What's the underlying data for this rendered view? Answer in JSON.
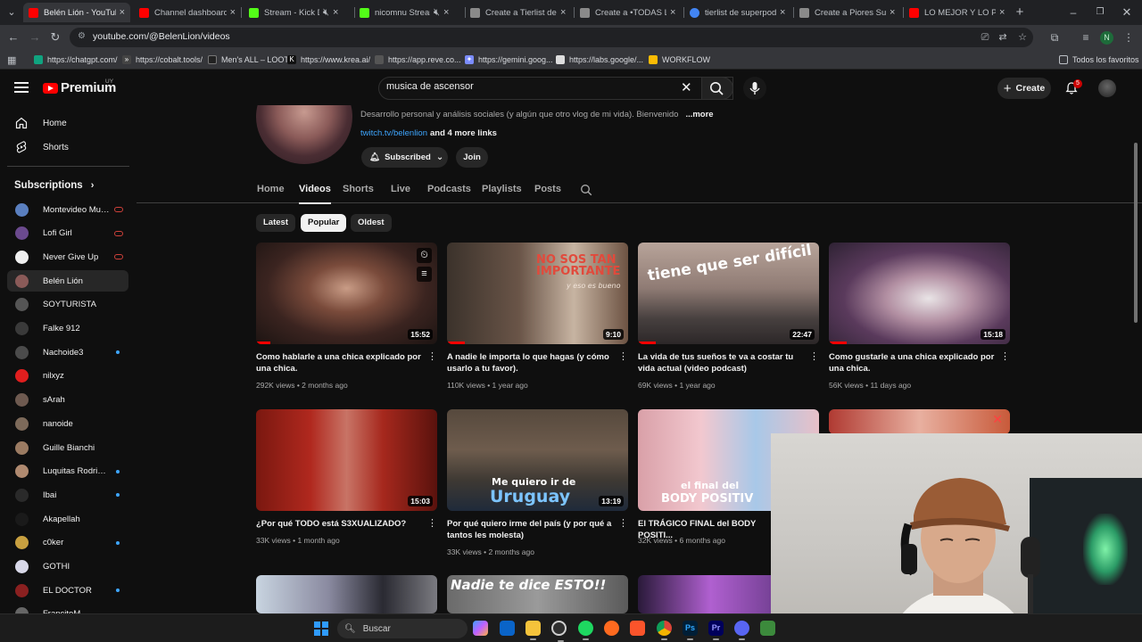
{
  "browser": {
    "tabs": [
      {
        "title": "Belén Lión - YouTube",
        "active": true,
        "favicon_color": "#ff0000"
      },
      {
        "title": "Channel dashboard -",
        "active": false,
        "favicon_color": "#ff0000"
      },
      {
        "title": "Stream - Kick Das",
        "active": false,
        "favicon_color": "#53fc18",
        "muted": true
      },
      {
        "title": "nicomnu Stream",
        "active": false,
        "favicon_color": "#53fc18",
        "muted": true
      },
      {
        "title": "Create a Tierlist de vi",
        "active": false,
        "favicon_color": "#8a8a8a"
      },
      {
        "title": "Create a •TODAS LAS",
        "active": false,
        "favicon_color": "#8a8a8a"
      },
      {
        "title": "tierlist de superpode",
        "active": false,
        "favicon_color": "#4285f4"
      },
      {
        "title": "Create a Piores Supe",
        "active": false,
        "favicon_color": "#8a8a8a"
      },
      {
        "title": "LO MEJOR Y LO PEO",
        "active": false,
        "favicon_color": "#ff0000"
      }
    ],
    "new_tab": "+",
    "url": "youtube.com/@BelenLion/videos",
    "profile_initial": "N",
    "bookmarks": [
      {
        "label": "https://chatgpt.com/",
        "icon_color": "#10a37f"
      },
      {
        "label": "https://cobalt.tools/",
        "icon_color": "#444444"
      },
      {
        "label": "Men's ALL – LOOT",
        "icon_color": "#222222"
      },
      {
        "label": "https://www.krea.ai/",
        "icon_color": "#111111"
      },
      {
        "label": "https://app.reve.co...",
        "icon_color": "#555555"
      },
      {
        "label": "https://gemini.goog...",
        "icon_color": "#7b8cff"
      },
      {
        "label": "https://labs.google/...",
        "icon_color": "#dddddd"
      },
      {
        "label": "WORKFLOW",
        "icon_color": "#fbbc04"
      }
    ],
    "all_bookmarks": "Todos los favoritos"
  },
  "youtube": {
    "logo_text": "Premium",
    "country_code": "UY",
    "search_query": "musica de ascensor",
    "create_label": "Create",
    "notifications_count": "5",
    "sidebar": {
      "items": [
        {
          "label": "Home",
          "icon": "home-icon"
        },
        {
          "label": "Shorts",
          "icon": "shorts-icon"
        }
      ],
      "subscriptions_heading": "Subscriptions",
      "subscriptions": [
        {
          "name": "Montevideo Mus...",
          "color": "#5a7fbf",
          "status": "live"
        },
        {
          "name": "Lofi Girl",
          "color": "#6b4a8e",
          "status": "live"
        },
        {
          "name": "Never Give Up",
          "color": "#f0f0f0",
          "status": "live"
        },
        {
          "name": "Belén Lión",
          "color": "#8a5a58",
          "status": "selected"
        },
        {
          "name": "SOYTURISTA",
          "color": "#555555",
          "status": "none"
        },
        {
          "name": "Falke 912",
          "color": "#3a3a3a",
          "status": "none"
        },
        {
          "name": "Nachoide3",
          "color": "#4b4b4b",
          "status": "new"
        },
        {
          "name": "nilxyz",
          "color": "#e01e1e",
          "status": "none"
        },
        {
          "name": "sArah",
          "color": "#6e5a50",
          "status": "none"
        },
        {
          "name": "nanoide",
          "color": "#7d6a5a",
          "status": "none"
        },
        {
          "name": "Guille Bianchi",
          "color": "#9b7b62",
          "status": "none"
        },
        {
          "name": "Luquitas Rodrigu...",
          "color": "#b08a70",
          "status": "new"
        },
        {
          "name": "Ibai",
          "color": "#2a2a2a",
          "status": "new"
        },
        {
          "name": "Akapellah",
          "color": "#1a1a1a",
          "status": "none"
        },
        {
          "name": "c0ker",
          "color": "#c8a040",
          "status": "new"
        },
        {
          "name": "GOTHI",
          "color": "#d8d8e8",
          "status": "none"
        },
        {
          "name": "EL DOCTOR",
          "color": "#8a2020",
          "status": "new"
        },
        {
          "name": "FrancitoM",
          "color": "#666666",
          "status": "none"
        }
      ]
    },
    "channel": {
      "description": "Desarrollo personal y análisis sociales (y algún que otro vlog de mi vida). Bienvenido",
      "more": "...more",
      "link": "twitch.tv/belenlion",
      "more_links": "and 4 more links",
      "subscribed_label": "Subscribed",
      "join_label": "Join",
      "tabs": [
        "Home",
        "Videos",
        "Shorts",
        "Live",
        "Podcasts",
        "Playlists",
        "Posts"
      ],
      "active_tab": "Videos",
      "filters": [
        "Latest",
        "Popular",
        "Oldest"
      ],
      "active_filter": "Popular"
    },
    "videos": [
      {
        "title": "Como hablarle a una chica explicado por una chica.",
        "views": "292K views",
        "age": "2 months ago",
        "duration": "15:52",
        "watched": 0.08,
        "overlay": ""
      },
      {
        "title": "A nadie le importa lo que hagas (y cómo usarlo a tu favor).",
        "views": "110K views",
        "age": "1 year ago",
        "duration": "9:10",
        "watched": 0.1,
        "overlay": "NO SOS TAN IMPORTANTE",
        "overlay_sub": "y eso es bueno"
      },
      {
        "title": "La vida de tus sueños te va a costar tu vida actual (video podcast)",
        "views": "69K views",
        "age": "1 year ago",
        "duration": "22:47",
        "watched": 0.1,
        "overlay": "tiene que ser difícil"
      },
      {
        "title": "Como gustarle a una chica explicado por una chica.",
        "views": "56K views",
        "age": "11 days ago",
        "duration": "15:18",
        "watched": 0.1,
        "overlay": ""
      },
      {
        "title": "¿Por qué TODO está S3XUALIZADO?",
        "views": "33K views",
        "age": "1 month ago",
        "duration": "15:03",
        "watched": 0,
        "overlay": ""
      },
      {
        "title": "Por qué quiero irme del país (y por qué a tantos les molesta)",
        "views": "33K views",
        "age": "2 months ago",
        "duration": "13:19",
        "watched": 0,
        "overlay": "Me quiero ir de",
        "overlay_big": "Uruguay"
      },
      {
        "title": "El TRÁGICO FINAL del BODY POSITI...",
        "views": "32K views",
        "age": "6 months ago",
        "duration": "",
        "watched": 0,
        "overlay": "el final del",
        "overlay_big": "BODY POSITIV"
      },
      {
        "title": "",
        "views": "",
        "age": "",
        "duration": "",
        "watched": 0,
        "overlay": ""
      },
      {
        "title": "",
        "views": "",
        "age": "",
        "duration": "",
        "watched": 0,
        "overlay": ""
      },
      {
        "title": "",
        "views": "",
        "age": "",
        "duration": "",
        "watched": 0,
        "overlay": "Nadie te dice ESTO!!"
      },
      {
        "title": "",
        "views": "",
        "age": "",
        "duration": "",
        "watched": 0,
        "overlay": ""
      }
    ]
  },
  "taskbar": {
    "search_placeholder": "Buscar",
    "apps": [
      "copilot-icon",
      "outlook-icon",
      "file-explorer-icon",
      "obs-icon",
      "spotify-icon",
      "firefox-icon",
      "brave-icon",
      "chrome-icon",
      "photoshop-icon",
      "premiere-icon",
      "discord-icon",
      "other-app-icon"
    ]
  }
}
